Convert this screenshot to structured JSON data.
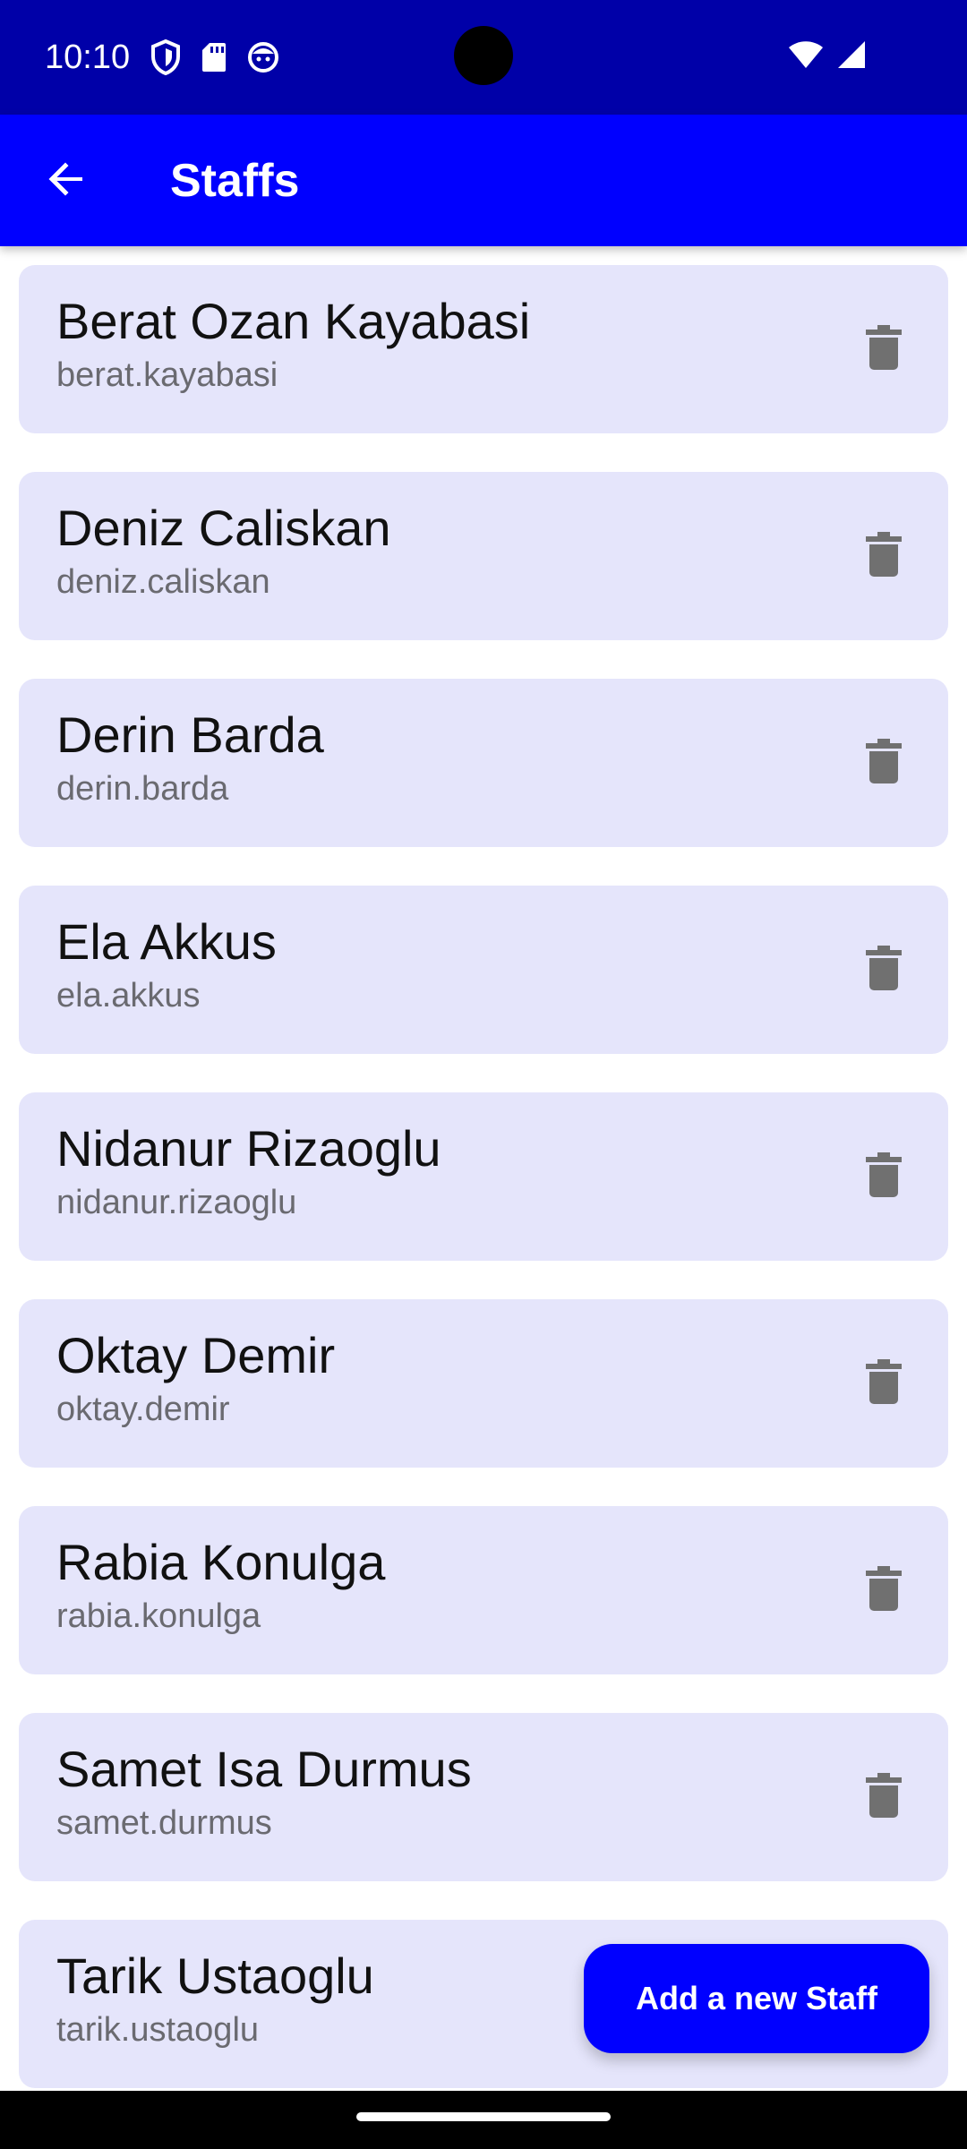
{
  "status_bar": {
    "time": "10:10",
    "icons_left": [
      "shield-icon",
      "sd-card-icon",
      "face-icon"
    ],
    "icons_right": [
      "wifi-icon",
      "cell-signal-icon"
    ]
  },
  "app_bar": {
    "title": "Staffs",
    "back_icon": "arrow-back-icon"
  },
  "staff": [
    {
      "name": "Berat Ozan Kayabasi",
      "username": "berat.kayabasi"
    },
    {
      "name": "Deniz Caliskan",
      "username": "deniz.caliskan"
    },
    {
      "name": "Derin Barda",
      "username": "derin.barda"
    },
    {
      "name": "Ela Akkus",
      "username": "ela.akkus"
    },
    {
      "name": "Nidanur Rizaoglu",
      "username": "nidanur.rizaoglu"
    },
    {
      "name": "Oktay Demir",
      "username": "oktay.demir"
    },
    {
      "name": "Rabia Konulga",
      "username": "rabia.konulga"
    },
    {
      "name": "Samet Isa Durmus",
      "username": "samet.durmus"
    },
    {
      "name": "Tarik Ustaoglu",
      "username": "tarik.ustaoglu"
    }
  ],
  "fab": {
    "label": "Add a new Staff"
  },
  "colors": {
    "status_bar": "#0000a8",
    "app_bar": "#0000ff",
    "card_background": "#e5e5fb",
    "username_text": "#6a6a70",
    "delete_icon": "#707070"
  }
}
